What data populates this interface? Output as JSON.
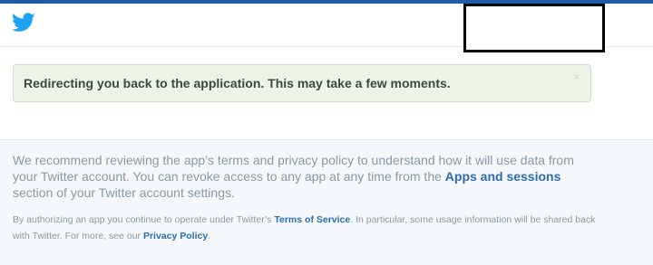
{
  "colors": {
    "top_bar": "#1f5aa6",
    "twitter_blue": "#1da1f2",
    "alert_bg": "#ecf4e8",
    "link": "#2b6cb0",
    "muted_text": "#8899a6"
  },
  "header": {
    "logo_icon": "twitter-bird-icon"
  },
  "alert": {
    "message": "Redirecting you back to the application. This may take a few moments.",
    "dismiss": "×"
  },
  "footer": {
    "paragraph_1": {
      "text_before": "We recommend reviewing the app’s terms and privacy policy to understand how it will use data from your Twitter account. You can revoke access to any app at any time from the",
      "link_text": "Apps and sessions",
      "text_after": "section of your Twitter account settings."
    },
    "paragraph_2": {
      "text_before": "By authorizing an app you continue to operate under Twitter’s",
      "tos_link": "Terms of Service",
      "text_middle": ". In particular, some usage information will be shared back with Twitter. For more, see our",
      "privacy_link": "Privacy Policy",
      "text_after": "."
    }
  }
}
